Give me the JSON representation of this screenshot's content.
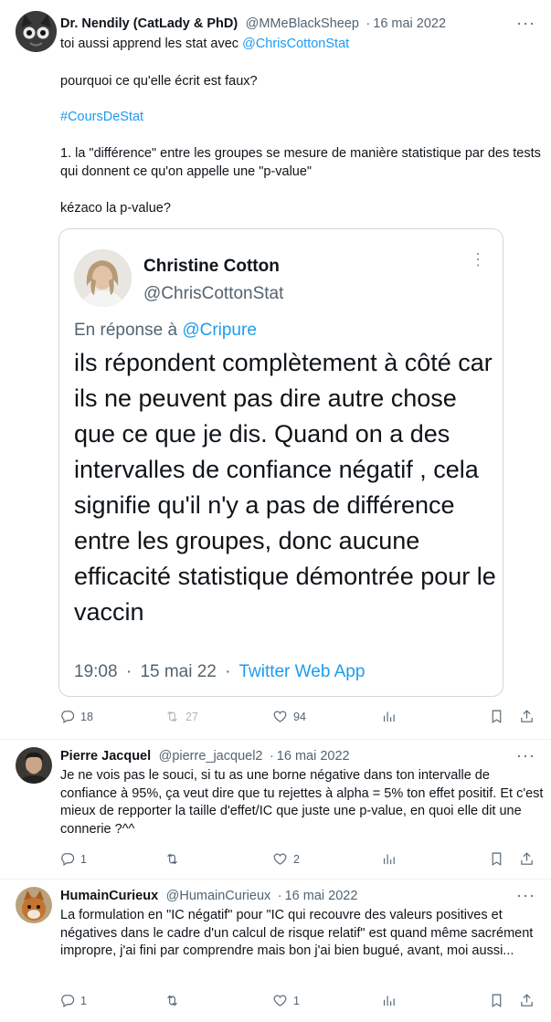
{
  "tweets": [
    {
      "author": "Dr. Nendily (CatLady & PhD)",
      "handle": "@MMeBlackSheep",
      "sep": "·",
      "date": "16 mai 2022",
      "line1_prefix": "toi aussi apprend les stat avec ",
      "line1_mention": "@ChrisCottonStat",
      "para2": "pourquoi ce qu'elle écrit est faux?",
      "hashtag": "#CoursDeStat",
      "para3": "1. la \"différence\" entre les groupes se mesure de manière statistique par des tests qui donnent ce qu'on appelle une \"p-value\"",
      "para4": "kézaco la p-value?",
      "replies": "18",
      "retweets": "27",
      "likes": "94"
    },
    {
      "author": "Pierre Jacquel",
      "handle": "@pierre_jacquel2",
      "sep": "·",
      "date": "16 mai 2022",
      "text": "Je ne vois pas le souci, si tu as une borne négative dans ton intervalle de confiance à 95%, ça veut dire que tu rejettes à alpha = 5% ton effet positif. Et c'est mieux de repporter la taille d'effet/IC que juste une p-value, en quoi elle dit une connerie ?^^",
      "replies": "1",
      "retweets": "",
      "likes": "2"
    },
    {
      "author": "HumainCurieux",
      "handle": "@HumainCurieux",
      "sep": "·",
      "date": "16 mai 2022",
      "text": "La formulation en \"IC négatif\" pour \"IC qui recouvre des valeurs positives et négatives dans le cadre d'un calcul de risque relatif\" est quand même sacrément impropre, j'ai fini par comprendre mais bon j'ai bien bugué, avant, moi aussi...",
      "replies": "1",
      "retweets": "",
      "likes": "1"
    }
  ],
  "quoted": {
    "author": "Christine Cotton",
    "handle": "@ChrisCottonStat",
    "reply_prefix": "En réponse à ",
    "reply_mention": "@Cripure",
    "text": "ils répondent complètement à côté car ils ne peuvent pas dire autre chose que ce que je dis. Quand on a des intervalles de confiance négatif , cela signifie qu'il n'y a pas de différence entre les groupes, donc aucune efficacité statistique démontrée pour le vaccin",
    "time": "19:08",
    "sep1": "·",
    "date": "15 mai 22",
    "sep2": "·",
    "client": "Twitter Web App"
  },
  "icons": {
    "more": "more-icon",
    "reply": "reply-icon",
    "retweet": "retweet-icon",
    "like": "like-icon",
    "views": "views-icon",
    "bookmark": "bookmark-icon",
    "share": "share-icon"
  },
  "colors": {
    "link": "#1d9bf0",
    "secondary_text": "#536471",
    "primary_text": "#0f1419",
    "border": "#cfd9de"
  }
}
